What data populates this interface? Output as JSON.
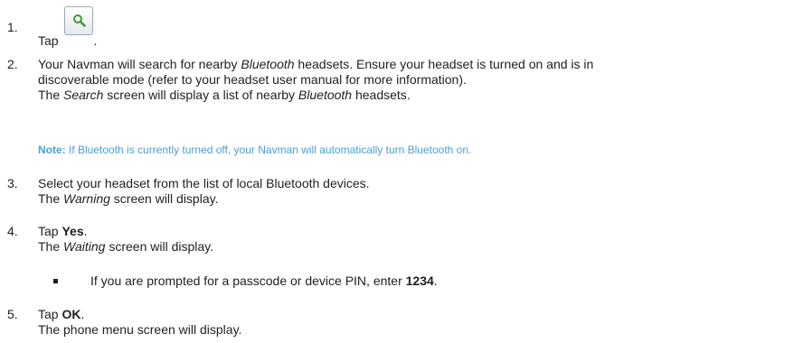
{
  "steps": {
    "s1": {
      "num": "1.",
      "text": "Tap",
      "icon": "search-icon",
      "trailing": "."
    },
    "s2": {
      "num": "2.",
      "line1": {
        "a": "Your Navman will search for nearby ",
        "em": "Bluetooth",
        "b": " headsets. Ensure your headset is turned on and is in"
      },
      "line2": "discoverable mode (refer to your headset user manual for more information).",
      "line3": {
        "a": "The ",
        "em1": "Search",
        "b": " screen will display a list of nearby ",
        "em2": "Bluetooth",
        "c": " headsets."
      }
    },
    "note": {
      "label": "Note:",
      "text": " If Bluetooth is currently turned off, your Navman will automatically turn Bluetooth on."
    },
    "s3": {
      "num": "3.",
      "line1": "Select your headset from the list of local Bluetooth devices.",
      "line2": {
        "a": "The ",
        "em": "Warning",
        "b": " screen will display."
      }
    },
    "s4": {
      "num": "4.",
      "line1": {
        "a": "Tap ",
        "strong": "Yes",
        "b": "."
      },
      "line2": {
        "a": "The ",
        "em": "Waiting",
        "b": " screen will display."
      }
    },
    "bullet": {
      "a": "If you are prompted for a passcode or device PIN, enter ",
      "strong": "1234",
      "b": "."
    },
    "s5": {
      "num": "5.",
      "line1": {
        "a": "Tap ",
        "strong": "OK",
        "b": "."
      },
      "line2": "The phone menu screen will display."
    }
  },
  "colors": {
    "text": "#1f1f1f",
    "note": "#4a9fd4",
    "icon": "#3d9b35"
  }
}
